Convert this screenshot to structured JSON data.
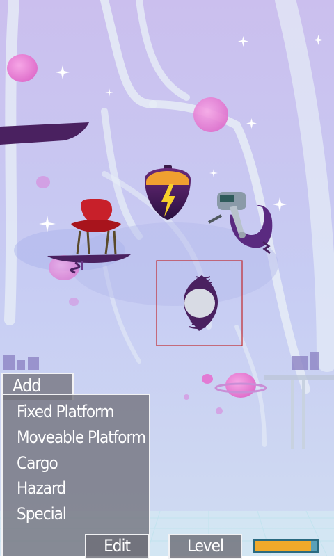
{
  "add_panel": {
    "title": "Add",
    "items": [
      "Fixed Platform",
      "Moveable Platform",
      "Cargo",
      "Hazard",
      "Special"
    ]
  },
  "bottom_bar": {
    "edit_label": "Edit",
    "level_label": "Level",
    "meter_fill": 0.9
  },
  "colors": {
    "sky_top": "#cfc4ef",
    "sky_bottom": "#c9d2f4",
    "platform_purple": "#4a2160",
    "menu_bg": "#767680",
    "meter_orange": "#f0a92a",
    "selection_red": "#c0282c"
  },
  "scene_objects": [
    "floating-platform",
    "red-chair-cargo",
    "lightning-bomb-hazard",
    "outboard-motor-cargo",
    "spinning-orb-special"
  ]
}
